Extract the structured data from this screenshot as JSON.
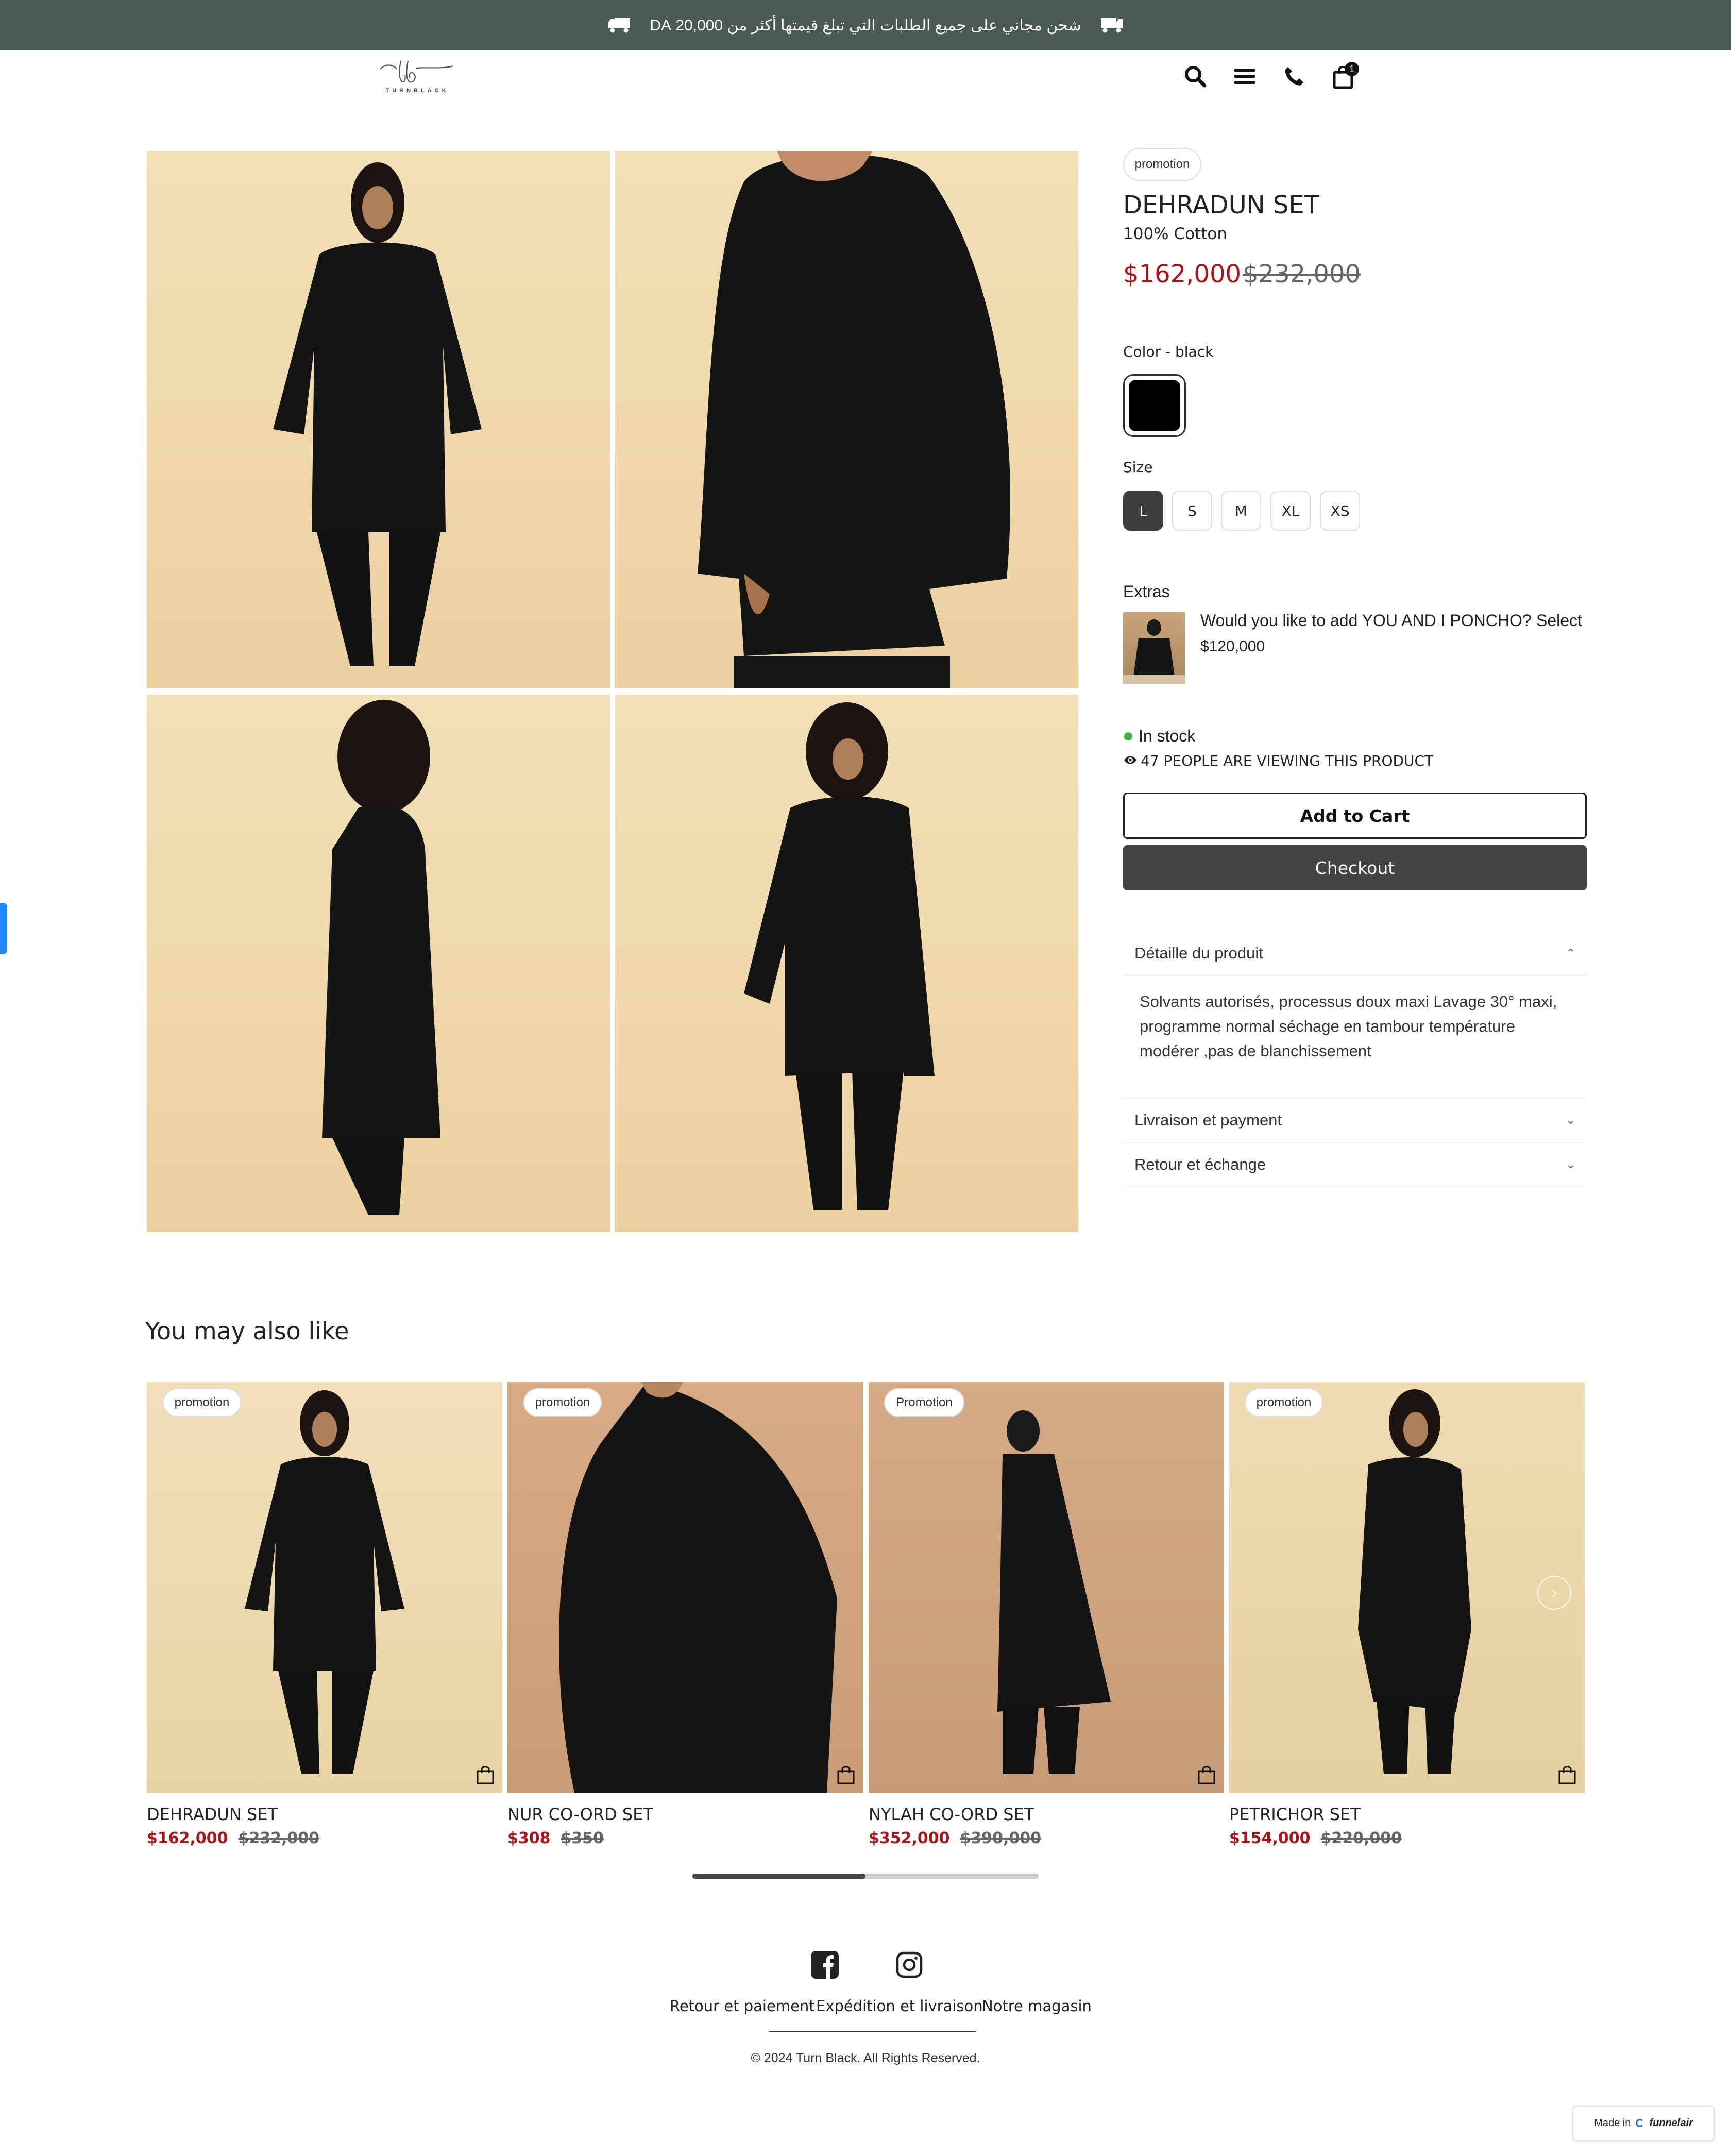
{
  "announcement": {
    "text": "شحن مجاني على جميع الطلبات التي تبلغ قيمتها أكثر من 20,000 DA"
  },
  "header": {
    "logo_text": "TURNBLACK",
    "cart_count": "1"
  },
  "product": {
    "badge": "promotion",
    "title": "DEHRADUN SET",
    "subtitle": "100% Cotton",
    "price": "$162,000",
    "compare_price": "$232,000",
    "color_label": "Color - black",
    "swatch_color": "#000000",
    "size_label": "Size",
    "sizes": [
      "L",
      "S",
      "M",
      "XL",
      "XS"
    ],
    "selected_size": "L",
    "extras_label": "Extras",
    "extra_question": "Would you like to add YOU AND I PONCHO?",
    "extra_select": "Select",
    "extra_price": "$120,000",
    "stock_text": "In stock",
    "viewers_text": "47 PEOPLE ARE VIEWING THIS PRODUCT",
    "add_to_cart": "Add to Cart",
    "checkout": "Checkout"
  },
  "accordion": [
    {
      "title": "Détaille du produit",
      "open": true,
      "body": "Solvants autorisés, processus doux maxi Lavage 30° maxi, programme normal séchage en tambour température modérer ,pas de blanchissement"
    },
    {
      "title": "Livraison et payment",
      "open": false
    },
    {
      "title": "Retour et échange",
      "open": false
    }
  ],
  "related": {
    "heading": "You may also like",
    "items": [
      {
        "badge": "promotion",
        "title": "DEHRADUN SET",
        "price": "$162,000",
        "compare": "$232,000"
      },
      {
        "badge": "promotion",
        "title": "NUR CO-ORD SET",
        "price": "$308",
        "compare": "$350"
      },
      {
        "badge": "Promotion",
        "title": "NYLAH CO-ORD SET",
        "price": "$352,000",
        "compare": "$390,000"
      },
      {
        "badge": "promotion",
        "title": "PETRICHOR SET",
        "price": "$154,000",
        "compare": "$220,000"
      }
    ],
    "scroll_progress": 0.5
  },
  "footer": {
    "links": [
      "Retour et paiement",
      "Expédition et livraison",
      "Notre magasin"
    ],
    "copyright": "© 2024 Turn Black. All Rights Reserved.",
    "made_in": "Made in",
    "made_brand": "funnelair"
  },
  "colors": {
    "topbar": "#4b5a52",
    "price": "#a8151a",
    "accent_button": "#444444",
    "in_stock_dot": "#3cb54a"
  }
}
